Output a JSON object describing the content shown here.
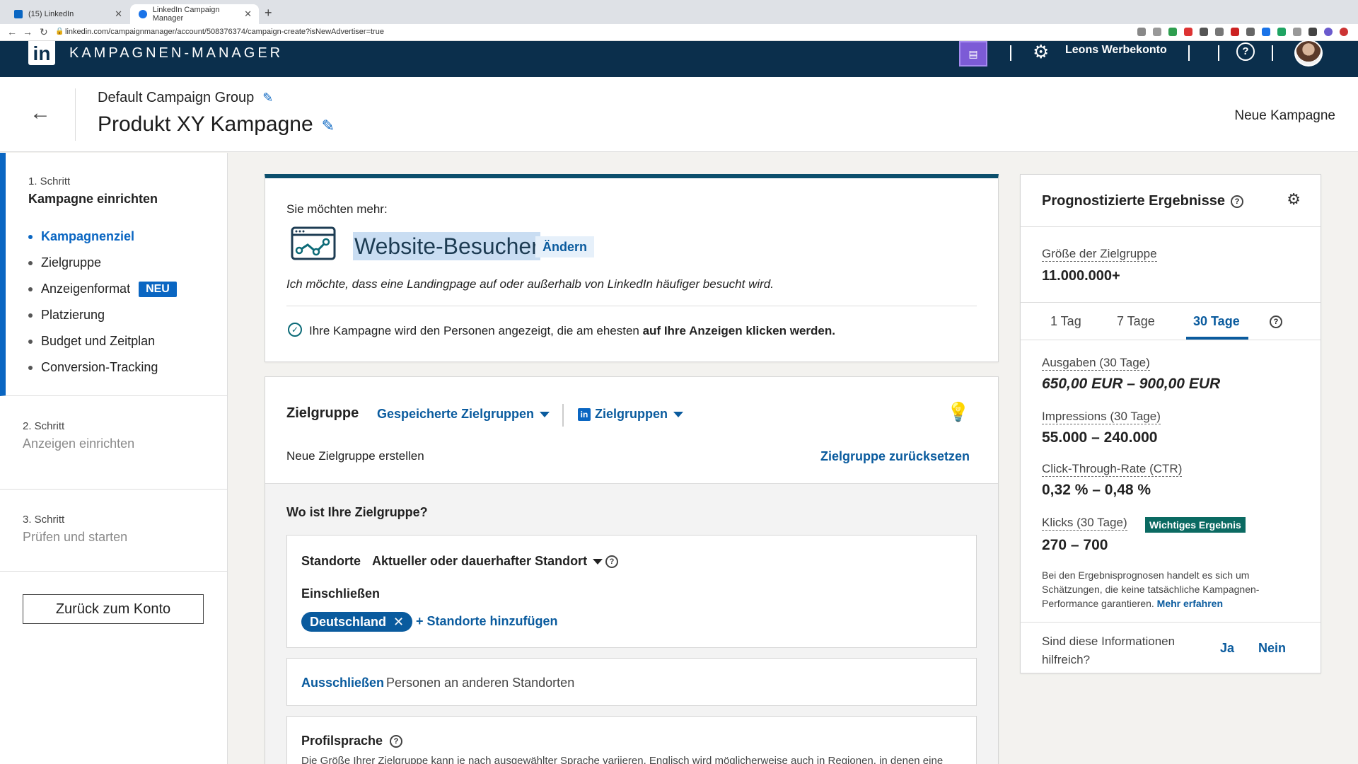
{
  "browser": {
    "tabs": [
      {
        "label": "(15) LinkedIn"
      },
      {
        "label": "LinkedIn Campaign Manager"
      }
    ],
    "url": "linkedin.com/campaignmanager/account/508376374/campaign-create?isNewAdvertiser=true"
  },
  "header": {
    "logo": "in",
    "product_title": "KAMPAGNEN-MANAGER",
    "account_name": "Leons Werbekonto",
    "help_symbol": "?"
  },
  "campaign": {
    "group_name": "Default Campaign Group",
    "name": "Produkt XY Kampagne",
    "status_label": "Neue Kampagne"
  },
  "sidebar": {
    "step1": {
      "number": "1. Schritt",
      "title": "Kampagne einrichten",
      "items": [
        {
          "label": "Kampagnenziel"
        },
        {
          "label": "Zielgruppe"
        },
        {
          "label": "Anzeigenformat",
          "badge": "NEU"
        },
        {
          "label": "Platzierung"
        },
        {
          "label": "Budget und Zeitplan"
        },
        {
          "label": "Conversion-Tracking"
        }
      ]
    },
    "step2": {
      "number": "2. Schritt",
      "title": "Anzeigen einrichten"
    },
    "step3": {
      "number": "3. Schritt",
      "title": "Prüfen und starten"
    },
    "back_button": "Zurück zum Konto"
  },
  "goal": {
    "prompt": "Sie möchten mehr:",
    "title": "Website-Besucher",
    "change_label": "Ändern",
    "description": "Ich möchte, dass eine Landingpage auf oder außerhalb von LinkedIn häufiger besucht wird.",
    "info_prefix": "Ihre Kampagne wird den Personen angezeigt, die am ehesten ",
    "info_bold": "auf Ihre Anzeigen klicken werden."
  },
  "audience": {
    "title": "Zielgruppe",
    "saved_label": "Gespeicherte Zielgruppen",
    "groups_label": "Zielgruppen",
    "new_label": "Neue Zielgruppe erstellen",
    "reset_label": "Zielgruppe zurücksetzen",
    "where_question": "Wo ist Ihre Zielgruppe?",
    "locations_label": "Standorte",
    "location_type": "Aktueller oder dauerhafter Standort",
    "include_label": "Einschließen",
    "included_location": "Deutschland",
    "add_locations": "Standorte hinzufügen",
    "exclude_link": "Ausschließen",
    "exclude_text": "Personen an anderen Standorten",
    "language_title": "Profilsprache",
    "language_text": "Die Größe Ihrer Zielgruppe kann je nach ausgewählter Sprache variieren. Englisch wird möglicherweise auch in Regionen, in denen eine"
  },
  "forecast": {
    "title": "Prognostizierte Ergebnisse",
    "audience_size_label": "Größe der Zielgruppe",
    "audience_size_value": "11.000.000+",
    "tabs": [
      {
        "label": "1 Tag"
      },
      {
        "label": "7 Tage"
      },
      {
        "label": "30 Tage",
        "active": true
      }
    ],
    "metrics": [
      {
        "label": "Ausgaben (30 Tage)",
        "value": "650,00 EUR – 900,00 EUR"
      },
      {
        "label": "Impressions (30 Tage)",
        "value": "55.000 – 240.000"
      },
      {
        "label": "Click-Through-Rate (CTR)",
        "value": "0,32 % – 0,48 %"
      },
      {
        "label": "Klicks (30 Tage)",
        "value": "270 – 700",
        "badge": "Wichtiges Ergebnis"
      }
    ],
    "note": "Bei den Ergebnisprognosen handelt es sich um Schätzungen, die keine tatsächliche Kampagnen-Performance garantieren.",
    "note_link": "Mehr erfahren",
    "feedback_question": "Sind diese Informationen hilfreich?",
    "yes": "Ja",
    "no": "Nein"
  },
  "colors": {
    "header_bg": "#0b2f4c",
    "link_blue": "#0a5b9e",
    "accent_blue": "#0a66c2",
    "badge_green": "#0b6a62"
  }
}
